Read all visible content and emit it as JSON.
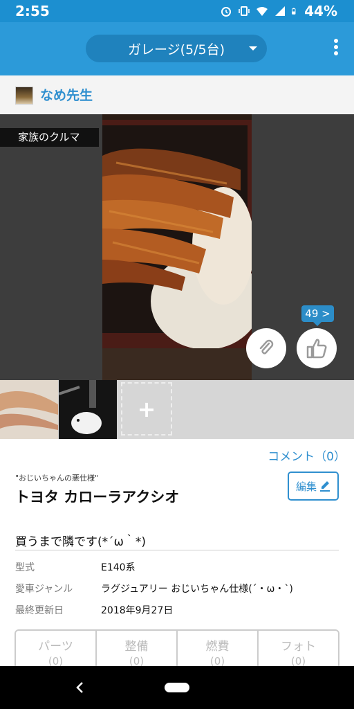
{
  "status": {
    "time": "2:55",
    "battery": "44%"
  },
  "app_bar": {
    "garage_title": "ガレージ(5/5台)"
  },
  "user": {
    "name": "なめ先生"
  },
  "photo": {
    "tag": "家族のクルマ",
    "likes": "49 >"
  },
  "thumbnails": {
    "add_label": "+"
  },
  "details": {
    "comment_link": "コメント（0）",
    "nickname": "\"おじいちゃんの悪仕様\"",
    "car_name": "トヨタ カローラアクシオ",
    "edit_label": "編集",
    "comment": "買うまで隣です(*´ω｀*)",
    "specs": [
      {
        "label": "型式",
        "value": "E140系"
      },
      {
        "label": "愛車ジャンル",
        "value": "ラグジュアリー おじいちゃん仕様(´・ω・`)"
      },
      {
        "label": "最終更新日",
        "value": "2018年9月27日"
      }
    ]
  },
  "tabs": [
    {
      "label": "パーツ",
      "count": "(0)"
    },
    {
      "label": "整備",
      "count": "(0)"
    },
    {
      "label": "燃費",
      "count": "(0)"
    },
    {
      "label": "フォト",
      "count": "(0)"
    }
  ],
  "icons": [
    "alarm-icon",
    "vibrate-icon",
    "wifi-icon",
    "signal-icon",
    "battery-icon",
    "chevron-down-icon",
    "more-vert-icon",
    "paperclip-icon",
    "thumbs-up-icon",
    "pencil-icon",
    "back-icon",
    "home-icon"
  ],
  "colors": {
    "app_bar": "#2c9ad9",
    "accent": "#2f8fcf",
    "status_bar": "#1c8fd0"
  }
}
